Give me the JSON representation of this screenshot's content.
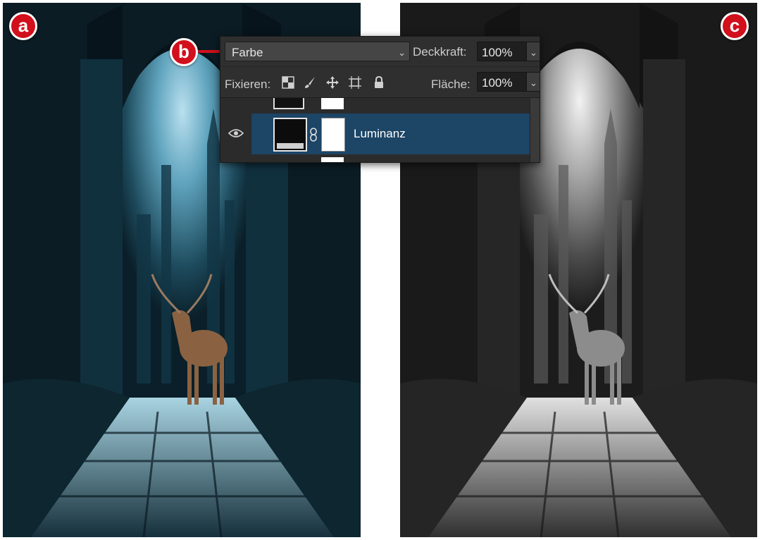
{
  "markers": {
    "a": "a",
    "b": "b",
    "c": "c"
  },
  "layers_panel": {
    "blend_mode": "Farbe",
    "opacity_label": "Deckkraft:",
    "opacity_value": "100%",
    "lock_label": "Fixieren:",
    "lock_icons": [
      "lock-transparent-pixels-icon",
      "lock-image-pixels-icon",
      "lock-position-icon",
      "lock-artboard-icon",
      "lock-all-icon"
    ],
    "fill_label": "Fläche:",
    "fill_value": "100%",
    "selected_layer": {
      "name": "Luminanz",
      "visible": true
    }
  },
  "colors": {
    "marker_red": "#d20f1c",
    "panel_bg": "#2f2f2f",
    "selection_blue": "#1c4566"
  }
}
